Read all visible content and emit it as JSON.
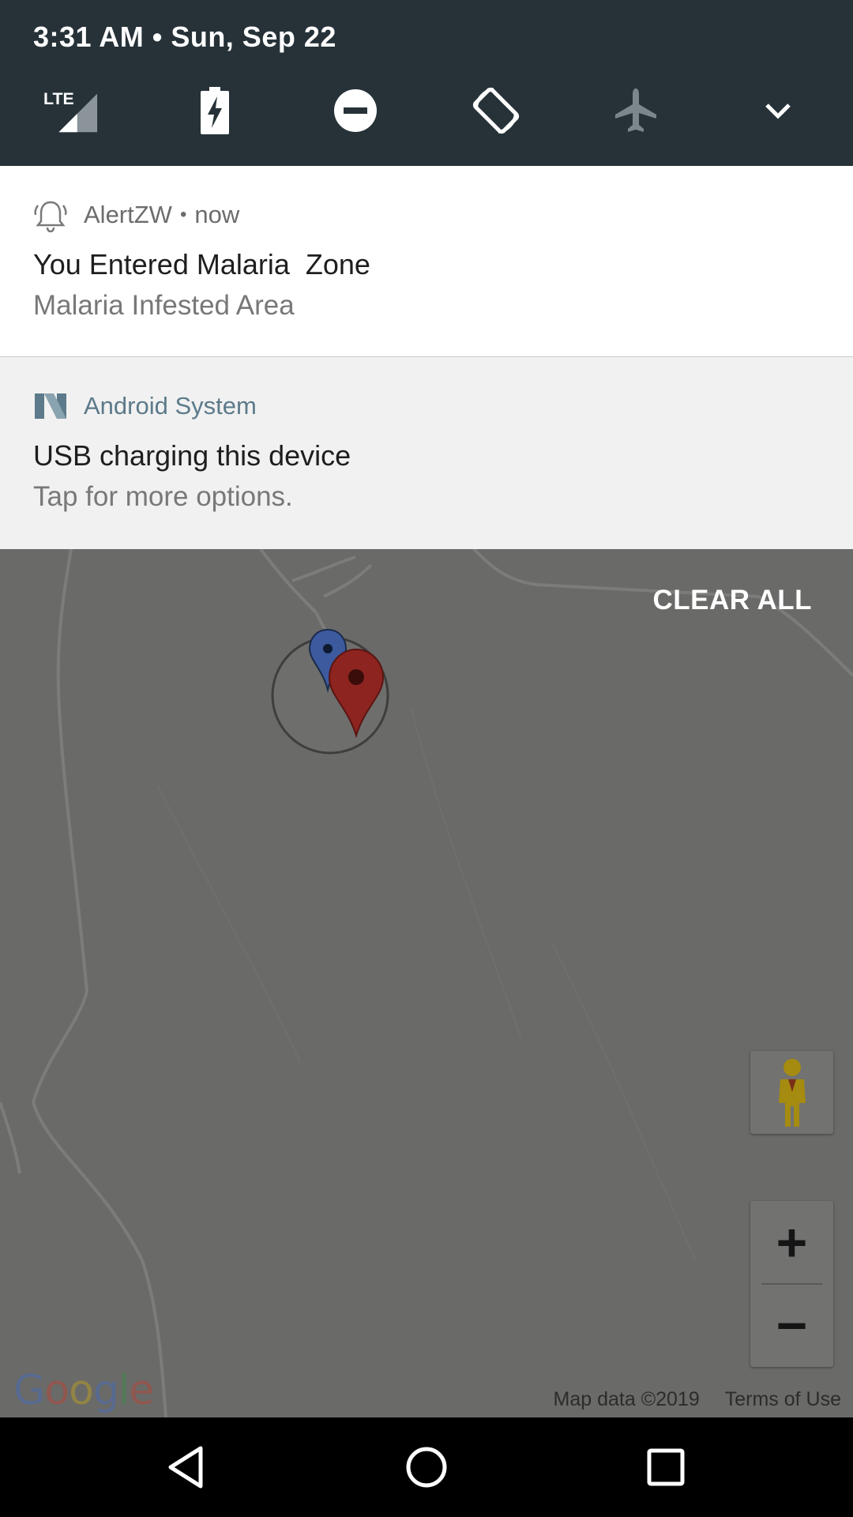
{
  "status": {
    "time_date": "3:31 AM • Sun, Sep 22"
  },
  "quick_settings": {
    "tiles": [
      {
        "icon": "lte-signal-icon",
        "label": "LTE"
      },
      {
        "icon": "battery-charging-icon"
      },
      {
        "icon": "do-not-disturb-icon"
      },
      {
        "icon": "auto-rotate-icon"
      },
      {
        "icon": "airplane-mode-icon"
      },
      {
        "icon": "expand-chevron-icon"
      }
    ]
  },
  "notifications": [
    {
      "icon": "bell-icon",
      "app": "AlertZW",
      "separator": "•",
      "when": "now",
      "title": "You Entered Malaria  Zone",
      "text": "Malaria Infested Area"
    },
    {
      "icon": "android-system-icon",
      "app": "Android System",
      "title": "USB charging this device",
      "text": "Tap for more options."
    }
  ],
  "clear_all": "CLEAR ALL",
  "map": {
    "logo": "Google",
    "attribution": "Map data ©2019",
    "terms": "Terms of Use",
    "zoom_in": "+",
    "zoom_out": "−",
    "markers": [
      {
        "icon": "blue-location-marker-icon",
        "color": "#3d5a9e"
      },
      {
        "icon": "red-location-marker-icon",
        "color": "#8e2420"
      }
    ]
  },
  "nav": {
    "buttons": [
      "back-icon",
      "home-icon",
      "recents-icon"
    ]
  }
}
